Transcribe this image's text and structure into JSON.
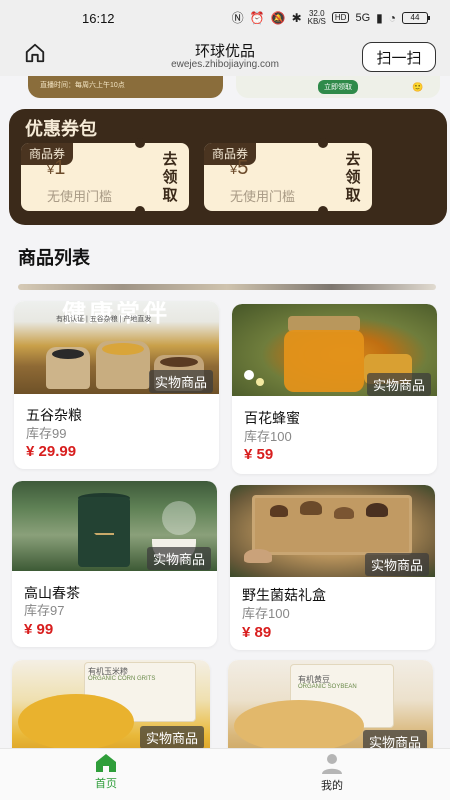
{
  "status_bar": {
    "time": "16:12",
    "net_speed_value": "32.0",
    "net_speed_unit": "KB/S",
    "hd": "HD",
    "signal": "5G",
    "battery": "44"
  },
  "header": {
    "title": "环球优品",
    "url": "ewejes.zhibojiaying.com",
    "scan_label": "扫一扫"
  },
  "banner": {
    "left_text": "直播时间：每周六上午10点",
    "right_button": "立即领取",
    "right_emoji": "🙂"
  },
  "coupon_pack": {
    "title": "优惠券包",
    "coupons": [
      {
        "tag": "商品券",
        "currency": "¥",
        "amount": "1",
        "condition": "无使用门槛",
        "claim": "去领取"
      },
      {
        "tag": "商品券",
        "currency": "¥",
        "amount": "5",
        "condition": "无使用门槛",
        "claim": "去领取"
      }
    ]
  },
  "product_list": {
    "title": "商品列表",
    "items": [
      {
        "name": "五谷杂粮",
        "stock": "库存99",
        "price": "¥ 29.99",
        "tag": "实物商品",
        "image_caption": "健康常伴",
        "image_subcaption": "有机认证 | 五谷杂粮 | 产地直发"
      },
      {
        "name": "百花蜂蜜",
        "stock": "库存100",
        "price": "¥ 59",
        "tag": "实物商品"
      },
      {
        "name": "高山春茶",
        "stock": "库存97",
        "price": "¥ 99",
        "tag": "实物商品"
      },
      {
        "name": "野生菌菇礼盒",
        "stock": "库存100",
        "price": "¥ 89",
        "tag": "实物商品"
      },
      {
        "tag": "实物商品",
        "image_caption": "有机玉米糁",
        "image_subcaption": "ORGANIC CORN GRITS"
      },
      {
        "tag": "实物商品",
        "image_caption": "有机黄豆",
        "image_subcaption": "ORGANIC SOYBEAN"
      }
    ]
  },
  "tabbar": {
    "tabs": [
      {
        "label": "首页",
        "active": true
      },
      {
        "label": "我的",
        "active": false
      }
    ]
  },
  "colors": {
    "accent_green": "#2f9e3a",
    "price_red": "#d81e1e",
    "coupon_dark": "#3b2a1a",
    "coupon_light": "#fbefd6"
  }
}
